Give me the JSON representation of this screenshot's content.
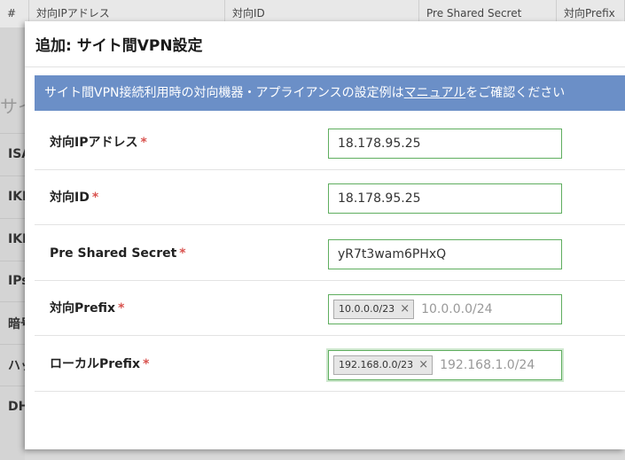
{
  "background": {
    "table_headers": [
      "#",
      "対向IPアドレス",
      "対向ID",
      "Pre Shared Secret",
      "対向Prefix"
    ],
    "heading_fragment": "サイ",
    "side_items": [
      "ISA",
      "IKE",
      "IKE",
      "IPs",
      "暗号",
      "ハッ",
      "DH"
    ]
  },
  "modal": {
    "title": "追加: サイト間VPN設定",
    "banner": {
      "before": "サイト間VPN接続利用時の対向機器・アプライアンスの設定例は",
      "link": "マニュアル",
      "after": "をご確認ください"
    },
    "required_mark": "*",
    "fields": [
      {
        "label": "対向IPアドレス",
        "value": "18.178.95.25"
      },
      {
        "label": "対向ID",
        "value": "18.178.95.25"
      },
      {
        "label": "Pre Shared Secret",
        "value": "yR7t3wam6PHxQ"
      },
      {
        "label": "対向Prefix",
        "tag": "10.0.0.0/23",
        "placeholder": "10.0.0.0/24"
      },
      {
        "label": "ローカルPrefix",
        "tag": "192.168.0.0/23",
        "placeholder": "192.168.1.0/24"
      }
    ],
    "tag_remove_glyph": "×"
  }
}
